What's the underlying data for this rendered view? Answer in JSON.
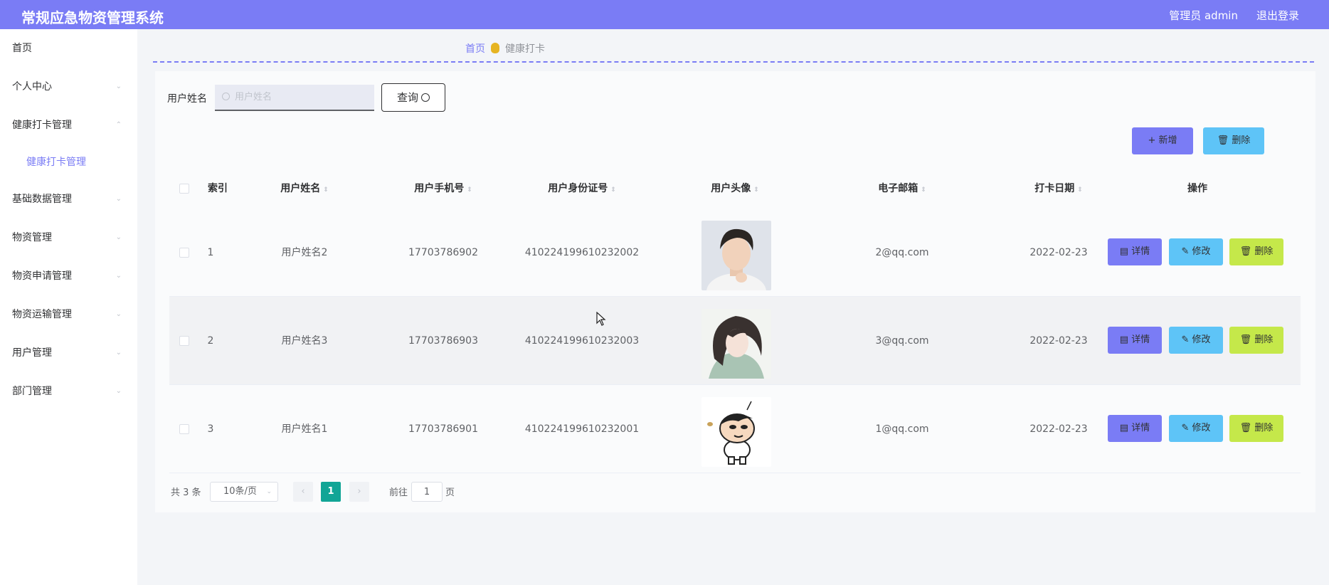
{
  "header": {
    "title": "常规应急物资管理系统",
    "user": "管理员 admin",
    "logout": "退出登录"
  },
  "sidebar": {
    "items": [
      {
        "label": "首页"
      },
      {
        "label": "个人中心"
      },
      {
        "label": "健康打卡管理"
      },
      {
        "label": "健康打卡管理",
        "sub": true
      },
      {
        "label": "基础数据管理"
      },
      {
        "label": "物资管理"
      },
      {
        "label": "物资申请管理"
      },
      {
        "label": "物资运输管理"
      },
      {
        "label": "用户管理"
      },
      {
        "label": "部门管理"
      }
    ]
  },
  "breadcrumb": {
    "home": "首页",
    "current": "健康打卡"
  },
  "search": {
    "label": "用户姓名",
    "placeholder": "用户姓名",
    "button": "查询"
  },
  "toolbar": {
    "add": "+ 新增",
    "delete": "删除"
  },
  "table": {
    "columns": [
      "索引",
      "用户姓名",
      "用户手机号",
      "用户身份证号",
      "用户头像",
      "电子邮箱",
      "打卡日期",
      "操作"
    ],
    "rows": [
      {
        "index": "1",
        "name": "用户姓名2",
        "phone": "17703786902",
        "idcard": "410224199610232002",
        "email": "2@qq.com",
        "date": "2022-02-23"
      },
      {
        "index": "2",
        "name": "用户姓名3",
        "phone": "17703786903",
        "idcard": "410224199610232003",
        "email": "3@qq.com",
        "date": "2022-02-23"
      },
      {
        "index": "3",
        "name": "用户姓名1",
        "phone": "17703786901",
        "idcard": "410224199610232001",
        "email": "1@qq.com",
        "date": "2022-02-23"
      }
    ],
    "actions": {
      "detail": "详情",
      "edit": "修改",
      "delete": "删除"
    }
  },
  "pagination": {
    "total": "共 3 条",
    "page_size": "10条/页",
    "current_page": "1",
    "goto_label": "前往",
    "goto_value": "1",
    "page_unit": "页"
  }
}
